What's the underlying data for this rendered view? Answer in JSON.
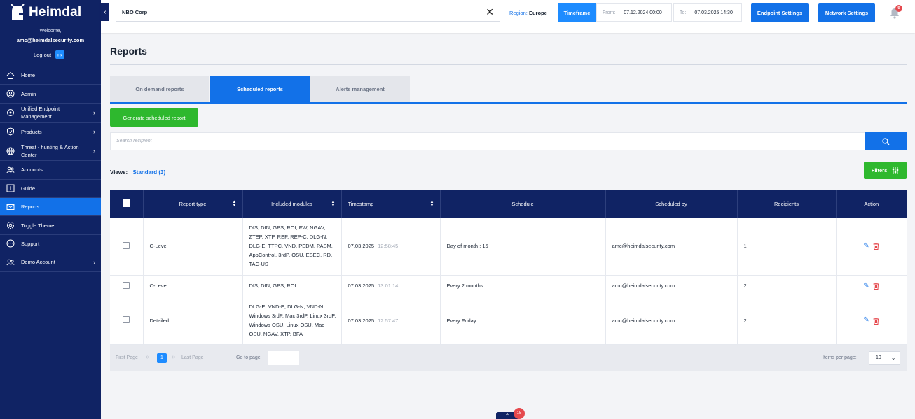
{
  "sidebar": {
    "brand": "Heimdal",
    "welcome": "Welcome,",
    "email": "amc@heimdalsecurity.com",
    "logout": "Log out",
    "items": [
      {
        "label": "Home",
        "icon": "home-icon"
      },
      {
        "label": "Admin",
        "icon": "admin-icon"
      },
      {
        "label": "Unified Endpoint Management",
        "icon": "endpoint-icon",
        "expandable": true
      },
      {
        "label": "Products",
        "icon": "shield-icon",
        "expandable": true
      },
      {
        "label": "Threat - hunting & Action Center",
        "icon": "globe-icon",
        "expandable": true
      },
      {
        "label": "Accounts",
        "icon": "users-icon"
      },
      {
        "label": "Guide",
        "icon": "info-icon"
      },
      {
        "label": "Reports",
        "icon": "mail-icon",
        "active": true
      },
      {
        "label": "Toggle Theme",
        "icon": "gear-icon"
      },
      {
        "label": "Support",
        "icon": "chat-icon"
      },
      {
        "label": "Demo Account",
        "icon": "users-icon",
        "expandable": true
      }
    ]
  },
  "topbar": {
    "company": "NBO Corp",
    "region_label": "Region:",
    "region_value": "Europe",
    "timeframe_label": "Timeframe",
    "from_label": "From:",
    "from_value": "07.12.2024 00:00",
    "to_label": "To:",
    "to_value": "07.03.2025 14:30",
    "endpoint_settings": "Endpoint Settings",
    "network_settings": "Network Settings",
    "notification_count": "9"
  },
  "main": {
    "title": "Reports",
    "tabs": [
      {
        "label": "On demand reports",
        "active": false
      },
      {
        "label": "Scheduled reports",
        "active": true
      },
      {
        "label": "Alerts management",
        "active": false
      }
    ],
    "generate_button": "Generate scheduled report",
    "search_placeholder": "Search recipient",
    "views_label": "Views:",
    "views_value": "Standard (3)",
    "filters_label": "Filters"
  },
  "table": {
    "columns": [
      "Report type",
      "Included modules",
      "Timestamp",
      "Schedule",
      "Scheduled by",
      "Recipients",
      "Action"
    ],
    "rows": [
      {
        "report_type": "C-Level",
        "modules": "DIS, DIN, GPS, ROI, FW, NGAV, ZTEP, XTP, REP, REP-C, DLG-N, DLG-E, TTPC, VND, PEDM, PASM, AppControl, 3rdP, OSU, ESEC, RD, TAC-US",
        "date": "07.03.2025",
        "time": "12:58:45",
        "schedule": "Day of month : 15",
        "scheduled_by": "amc@heimdalsecurity.com",
        "recipients": "1"
      },
      {
        "report_type": "C-Level",
        "modules": "DIS, DIN, GPS, ROI",
        "date": "07.03.2025",
        "time": "13:01:14",
        "schedule": "Every 2 months",
        "scheduled_by": "amc@heimdalsecurity.com",
        "recipients": "2"
      },
      {
        "report_type": "Detailed",
        "modules": "DLG-E, VND-E, DLG-N, VND-N, Windows 3rdP, Mac 3rdP, Linux 3rdP, Windows OSU, Linux OSU, Mac OSU, NGAV, XTP, BFA",
        "date": "07.03.2025",
        "time": "12:57:47",
        "schedule": "Every Friday",
        "scheduled_by": "amc@heimdalsecurity.com",
        "recipients": "2"
      }
    ]
  },
  "pagination": {
    "first": "First Page",
    "current": "1",
    "last": "Last Page",
    "goto_label": "Go to page:",
    "ipp_label": "Items per page:",
    "ipp_value": "10"
  },
  "footer": {
    "scroll_badge": "15"
  },
  "colors": {
    "sidebar": "#102364",
    "accent": "#1271e8",
    "green": "#2eb82e",
    "danger": "#e5484d"
  }
}
